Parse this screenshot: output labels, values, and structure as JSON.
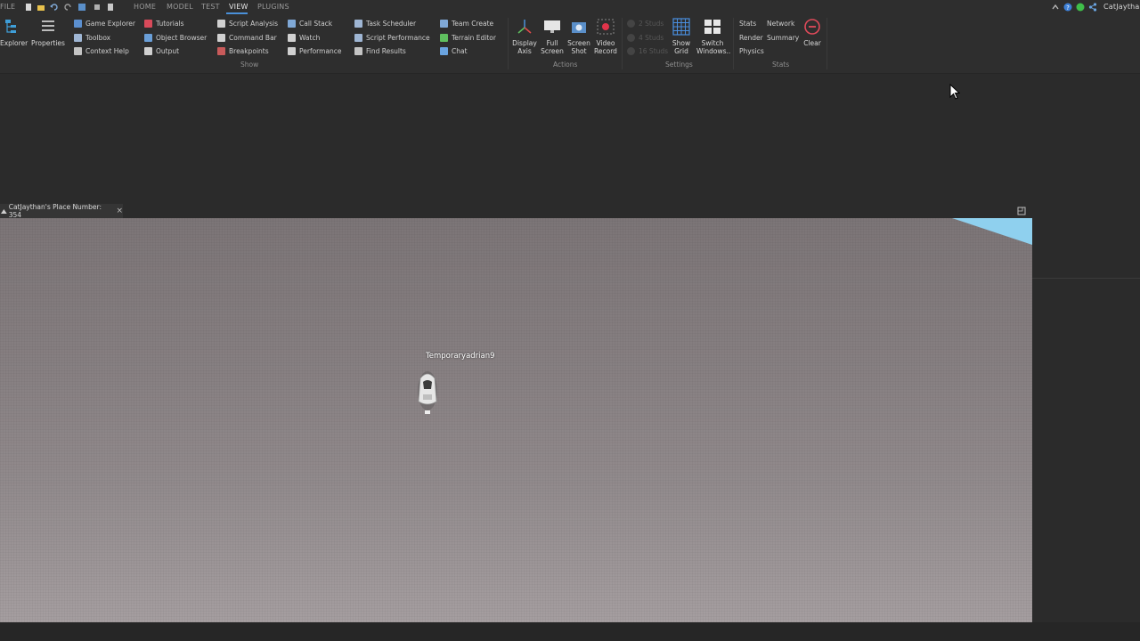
{
  "menu": {
    "file": "FILE",
    "tabs": [
      "HOME",
      "MODEL",
      "TEST",
      "VIEW",
      "PLUGINS"
    ],
    "active_tab": "VIEW",
    "username": "CatJaythan"
  },
  "ribbon": {
    "show": {
      "explorer": "Explorer",
      "properties": "Properties",
      "col1": [
        "Game Explorer",
        "Toolbox",
        "Context Help"
      ],
      "col2": [
        "Tutorials",
        "Object Browser",
        "Output"
      ],
      "col3": [
        "Script Analysis",
        "Command Bar",
        "Breakpoints"
      ],
      "col4": [
        "Call Stack",
        "Watch",
        "Performance"
      ],
      "col5": [
        "Task Scheduler",
        "Script Performance",
        "Find Results"
      ],
      "col6": [
        "Team Create",
        "Terrain Editor",
        "Chat"
      ],
      "label": "Show"
    },
    "actions": {
      "buttons": [
        {
          "line1": "Display",
          "line2": "Axis"
        },
        {
          "line1": "Full",
          "line2": "Screen"
        },
        {
          "line1": "Screen",
          "line2": "Shot"
        },
        {
          "line1": "Video",
          "line2": "Record"
        }
      ],
      "label": "Actions"
    },
    "settings": {
      "studs": [
        "2 Studs",
        "4 Studs",
        "16 Studs"
      ],
      "show_grid": {
        "line1": "Show",
        "line2": "Grid"
      },
      "switch_windows": {
        "line1": "Switch",
        "line2": "Windows.."
      },
      "label": "Settings"
    },
    "stats": {
      "col1": [
        "Stats",
        "Render",
        "Physics"
      ],
      "col2": [
        "Network",
        "Summary"
      ],
      "clear": "Clear",
      "label": "Stats"
    }
  },
  "document": {
    "tab_title": "CatJaythan's Place Number: 354",
    "close": "×"
  },
  "viewport": {
    "player_name": "Temporaryadrian9"
  },
  "colors": {
    "accent": "#4a90d9",
    "sky": "#8fd0ee",
    "record": "#e0344a"
  }
}
